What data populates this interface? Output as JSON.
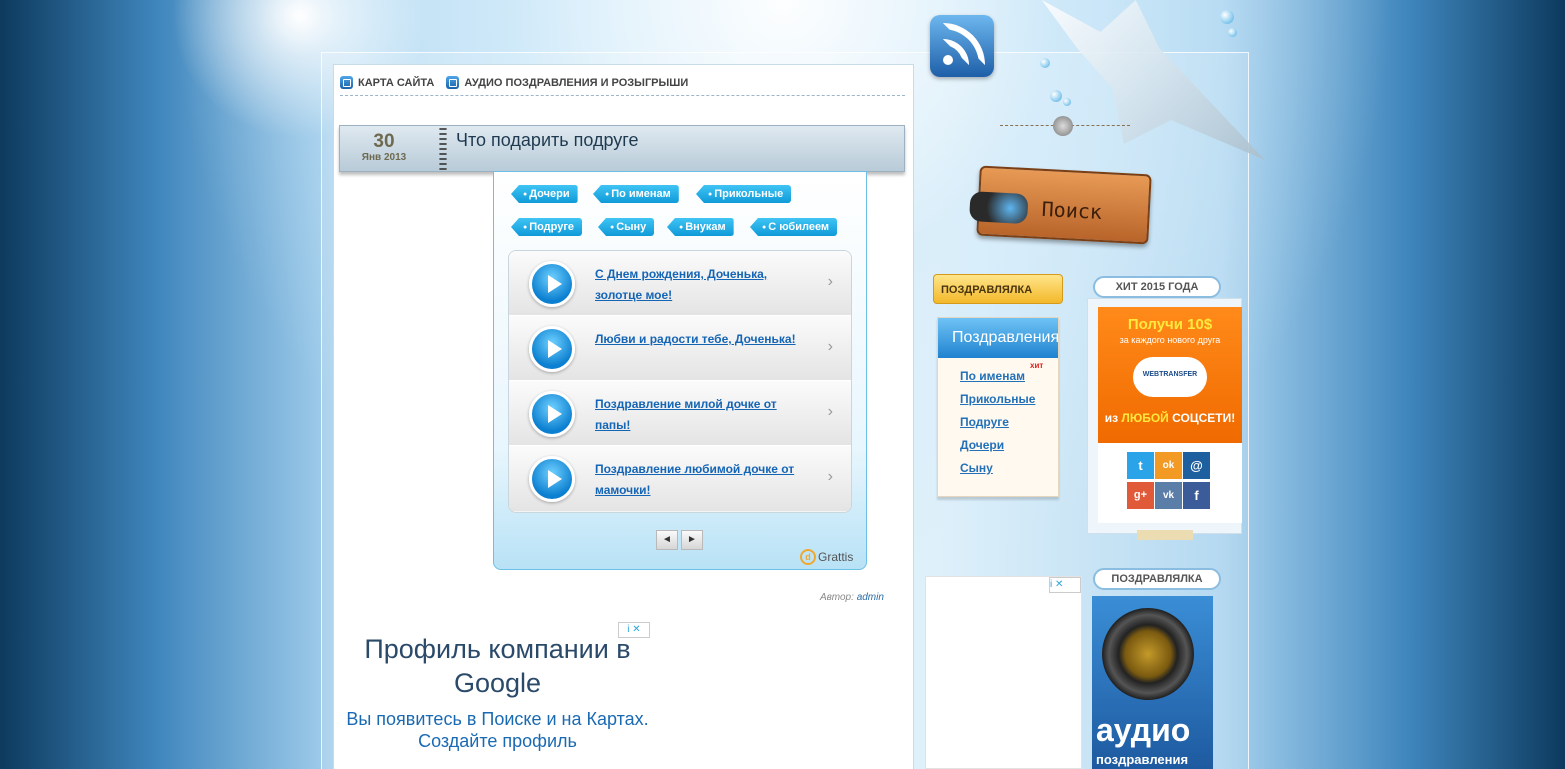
{
  "nav": {
    "items": [
      {
        "label": "КАРТА САЙТА"
      },
      {
        "label": "АУДИО ПОЗДРАВЛЕНИЯ И РОЗЫГРЫШИ"
      }
    ]
  },
  "post": {
    "day": "30",
    "month_year": "Янв 2013",
    "title": "Что подарить подруге",
    "author_label": "Автор:",
    "author": "admin"
  },
  "widget": {
    "tags": [
      "Дочери",
      "По именам",
      "Прикольные",
      "Подруге",
      "Сыну",
      "Внукам",
      "С юбилеем"
    ],
    "tracks": [
      {
        "title": "С Днем рождения, Доченька, золотце мое!"
      },
      {
        "title": "Любви и радости тебе, Доченька!"
      },
      {
        "title": "Поздравление милой дочке от папы!"
      },
      {
        "title": "Поздравление любимой дочке от мамочки!"
      }
    ],
    "prev": "◄",
    "next": "►",
    "brand": "Grattis"
  },
  "ad_main": {
    "headline": "Профиль компании в Google",
    "text": "Вы появитесь в Поиске и на Картах. Создайте профиль"
  },
  "search": {
    "label": "Поиск"
  },
  "sidebar_left": {
    "label": "ПОЗДРАВЛЯЛКА",
    "menu_title": "Поздравления",
    "hit_badge": "хит",
    "links": [
      "По именам",
      "Прикольные",
      "Подруге",
      "Дочери",
      "Сыну"
    ]
  },
  "sidebar_right": {
    "hit_label": "ХИТ 2015 ГОДА",
    "banner": {
      "big": "Получи 10$",
      "small": "за каждого нового друга",
      "logo": "WEBTRANSFER",
      "line_a": "из",
      "line_b": "ЛЮБОЙ",
      "line_c": "СОЦСЕТИ!"
    },
    "social": [
      {
        "glyph": "t",
        "color": "#2aa3e8"
      },
      {
        "glyph": "ok",
        "color": "#f29a24"
      },
      {
        "glyph": "@",
        "color": "#1e5fa0"
      },
      {
        "glyph": "g+",
        "color": "#e05a3a"
      },
      {
        "glyph": "vk",
        "color": "#5b7ea8"
      },
      {
        "glyph": "f",
        "color": "#3b5b99"
      }
    ],
    "pozdr_label": "ПОЗДРАВЛЯЛКА",
    "audio_word": "аудио",
    "audio_sub": "поздравления"
  },
  "ad_badge": "i ✕"
}
